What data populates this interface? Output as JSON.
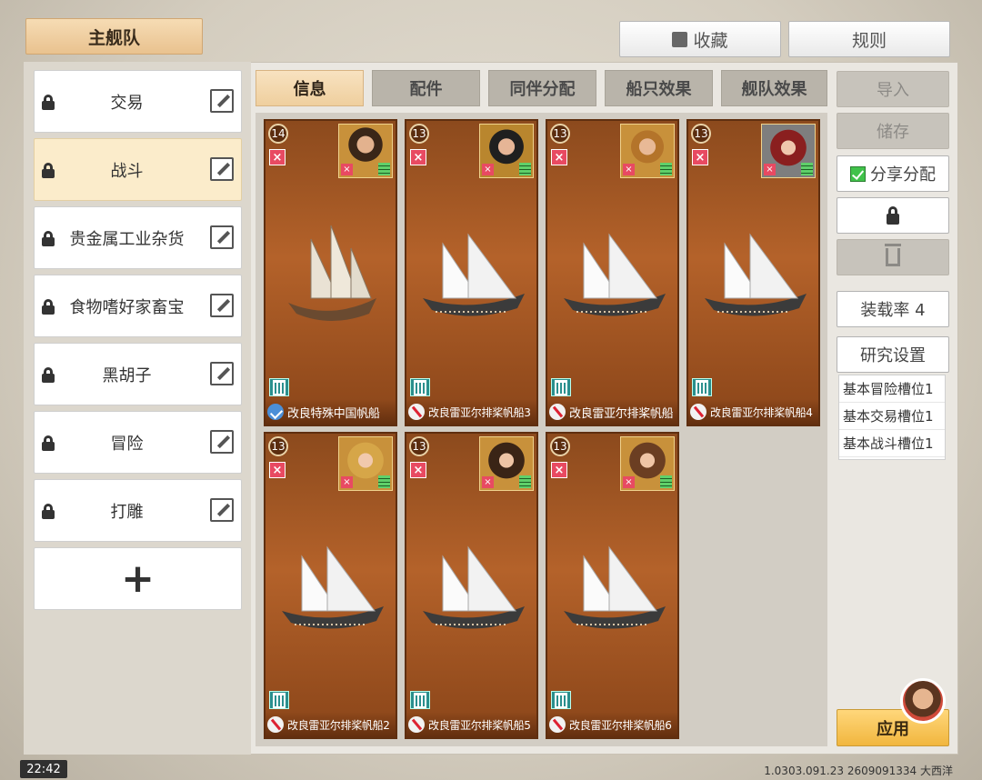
{
  "header": {
    "fleet_tab": "主舰队",
    "favorite_label": "收藏",
    "rules_label": "规则"
  },
  "fleets": [
    {
      "name": "交易"
    },
    {
      "name": "战斗"
    },
    {
      "name": "贵金属工业杂货"
    },
    {
      "name": "食物嗜好家畜宝"
    },
    {
      "name": "黑胡子"
    },
    {
      "name": "冒险"
    },
    {
      "name": "打雕"
    }
  ],
  "tabs": [
    "信息",
    "配件",
    "同伴分配",
    "船只效果",
    "舰队效果"
  ],
  "ships": [
    {
      "level": "14",
      "name": "改良特殊中国帆船",
      "type_icon": "blue-sail-icon"
    },
    {
      "level": "13",
      "name": "改良雷亚尔排桨帆船3",
      "type_icon": "red-sword-icon"
    },
    {
      "level": "13",
      "name": "改良雷亚尔排桨帆船",
      "type_icon": "red-sword-icon"
    },
    {
      "level": "13",
      "name": "改良雷亚尔排桨帆船4",
      "type_icon": "red-sword-icon"
    },
    {
      "level": "13",
      "name": "改良雷亚尔排桨帆船2",
      "type_icon": "red-sword-icon"
    },
    {
      "level": "13",
      "name": "改良雷亚尔排桨帆船5",
      "type_icon": "red-sword-icon"
    },
    {
      "level": "13",
      "name": "改良雷亚尔排桨帆船6",
      "type_icon": "red-sword-icon"
    }
  ],
  "sidebar": {
    "import_label": "导入",
    "save_label": "储存",
    "share_label": "分享分配",
    "load_rate_label": "装载率 4",
    "research_label": "研究设置",
    "slots": [
      "基本冒险槽位1",
      "基本交易槽位1",
      "基本战斗槽位1"
    ],
    "apply_label": "应用"
  },
  "footer": {
    "clock": "22:42",
    "info": "1.0303.091.23 2609091334 大西洋"
  },
  "colors": {
    "accent": "#efcf9e",
    "card": "#b4622a",
    "apply": "#f1b63e"
  }
}
